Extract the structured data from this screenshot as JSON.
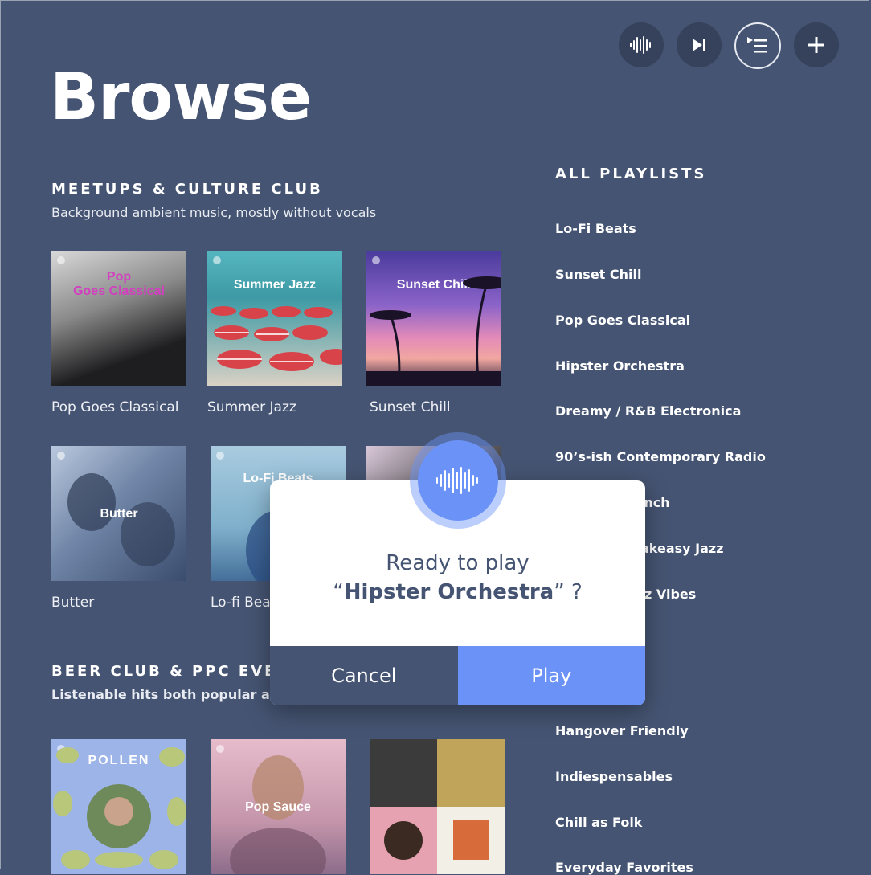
{
  "header": {
    "title": "Browse",
    "buttons": [
      {
        "icon": "waveform-icon"
      },
      {
        "icon": "skip-next-icon"
      },
      {
        "icon": "queue-icon"
      },
      {
        "icon": "plus-icon"
      }
    ]
  },
  "sections": [
    {
      "title": "MEETUPS & CULTURE CLUB",
      "subtitle": "Background ambient music, mostly without vocals",
      "playlists": [
        {
          "label": "Pop Goes Classical",
          "art_text": "Pop\nGoes Classical",
          "art_color": "#2b2b2e"
        },
        {
          "label": "Summer Jazz",
          "art_text": "Summer Jazz",
          "art_color": "#3d9aa5"
        },
        {
          "label": "Sunset Chill",
          "art_text": "Sunset Chill",
          "art_color": "#5b4fa8"
        },
        {
          "label": "Butter",
          "art_text": "Butter",
          "art_color": "#5f6f8c"
        },
        {
          "label": "Lo-fi Bea",
          "art_text": "Lo-Fi Beats",
          "art_color": "#8cb8cf"
        },
        {
          "label": "",
          "art_text": "",
          "art_color": "#2a2a2a"
        }
      ]
    },
    {
      "title": "BEER CLUB & PPC EVEN",
      "subtitle": "Listenable hits both popular and n",
      "playlists": [
        {
          "label": "",
          "art_text": "POLLEN",
          "art_color": "#9db4e8"
        },
        {
          "label": "",
          "art_text": "Pop Sauce",
          "art_color": "#d7a7b8"
        },
        {
          "label": "",
          "art_text": "",
          "art_color": "#3a3a3a"
        }
      ]
    }
  ],
  "all_playlists": {
    "title": "ALL PLAYLISTS",
    "items": [
      "Lo-Fi Beats",
      "Sunset Chill",
      "Pop Goes Classical",
      "Hipster Orchestra",
      "Dreamy / R&B Electronica",
      "90’s-ish Contemporary Radio",
      "unch",
      "akeasy Jazz",
      "z Vibes",
      "",
      "",
      "Hangover Friendly",
      "Indiespensables",
      "Chill as Folk",
      "Everyday Favorites"
    ]
  },
  "dialog": {
    "line1": "Ready to play",
    "open_quote": "“",
    "playlist_name": "Hipster Orchestra",
    "close_quote": "”",
    "question_mark": "?",
    "cancel_label": "Cancel",
    "play_label": "Play",
    "icon": "voice-waveform-icon",
    "accent": "#6b93f7"
  },
  "colors": {
    "background": "#455472",
    "accent": "#6b93f7"
  }
}
